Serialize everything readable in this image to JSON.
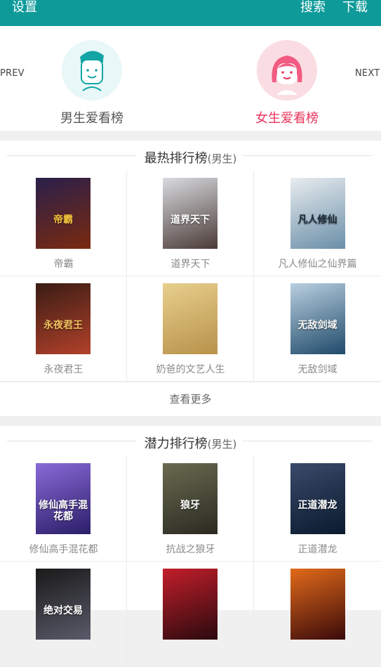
{
  "topbar": {
    "settings": "设置",
    "search": "搜索",
    "download": "下载"
  },
  "carousel": {
    "prev": "PREV",
    "next": "NEXT",
    "boy_label": "男生爱看榜",
    "girl_label": "女生爱看榜"
  },
  "sections": [
    {
      "title": "最热排行榜",
      "tag": "(男生)",
      "books": [
        "帝霸",
        "道界天下",
        "凡人修仙之仙界篇",
        "永夜君王",
        "奶爸的文艺人生",
        "无敌剑域"
      ],
      "more": "查看更多"
    },
    {
      "title": "潜力排行榜",
      "tag": "(男生)",
      "books": [
        "修仙高手混花都",
        "抗战之狼牙",
        "正道潜龙",
        "",
        "",
        ""
      ]
    }
  ],
  "covers": [
    {
      "text": "帝霸",
      "bg1": "#2a1f4a",
      "bg2": "#7a2a10",
      "fg": "#f2c23a"
    },
    {
      "text": "道界天下",
      "bg1": "#d9dbe0",
      "bg2": "#4a3a36",
      "fg": "#ffffff"
    },
    {
      "text": "凡人修仙",
      "bg1": "#e8ecef",
      "bg2": "#6a8fa8",
      "fg": "#1b2a38"
    },
    {
      "text": "永夜君王",
      "bg1": "#3a1c14",
      "bg2": "#b2412a",
      "fg": "#f0c060"
    },
    {
      "text": "",
      "bg1": "#e8cf8d",
      "bg2": "#b7924a",
      "fg": "#5a4222"
    },
    {
      "text": "无敌剑域",
      "bg1": "#b9cfe0",
      "bg2": "#1f4a6a",
      "fg": "#f7f7f7"
    },
    {
      "text": "修仙高手混花都",
      "bg1": "#8a6ad8",
      "bg2": "#2a1e68",
      "fg": "#ffffff"
    },
    {
      "text": "狼牙",
      "bg1": "#6a6a50",
      "bg2": "#2a2a22",
      "fg": "#ffffff"
    },
    {
      "text": "正道潜龙",
      "bg1": "#3a4a6a",
      "bg2": "#0a1a2e",
      "fg": "#ffffff"
    },
    {
      "text": "绝对交易",
      "bg1": "#1a1a1a",
      "bg2": "#5a5a6a",
      "fg": "#ffffff"
    },
    {
      "text": "",
      "bg1": "#c21e2a",
      "bg2": "#2a0a0e",
      "fg": "#ffffff"
    },
    {
      "text": "",
      "bg1": "#e26a1a",
      "bg2": "#3a0a0a",
      "fg": "#ffffff"
    }
  ],
  "colors": {
    "brand": "#0f9a9a",
    "girl_accent": "#e8345b"
  }
}
